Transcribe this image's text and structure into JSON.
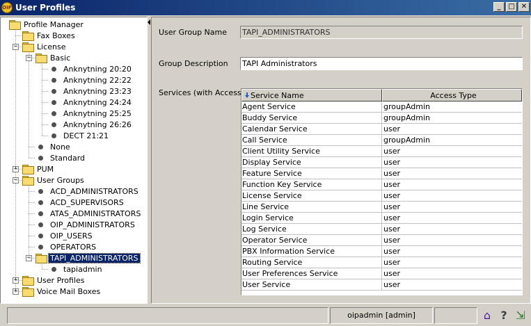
{
  "window": {
    "title": "User Profiles",
    "icon_text": "OIP",
    "buttons": {
      "minimize": "_",
      "maximize": "□",
      "close": "✕"
    }
  },
  "tree": {
    "items": [
      {
        "label": "Profile Manager",
        "type": "folder",
        "level": 0,
        "expanded": true
      },
      {
        "label": "Fax Boxes",
        "type": "folder",
        "level": 1
      },
      {
        "label": "License",
        "type": "folder",
        "level": 1,
        "expanded": true
      },
      {
        "label": "Basic",
        "type": "folder",
        "level": 2,
        "expanded": true
      },
      {
        "label": "Anknytning 20:20",
        "type": "leaf",
        "level": 3
      },
      {
        "label": "Anknytning 22:22",
        "type": "leaf",
        "level": 3
      },
      {
        "label": "Anknytning 23:23",
        "type": "leaf",
        "level": 3
      },
      {
        "label": "Anknytning 24:24",
        "type": "leaf",
        "level": 3
      },
      {
        "label": "Anknytning 25:25",
        "type": "leaf",
        "level": 3
      },
      {
        "label": "Anknytning 26:26",
        "type": "leaf",
        "level": 3
      },
      {
        "label": "DECT 21:21",
        "type": "leaf",
        "level": 3
      },
      {
        "label": "None",
        "type": "leaf",
        "level": 2
      },
      {
        "label": "Standard",
        "type": "leaf",
        "level": 2
      },
      {
        "label": "PUM",
        "type": "folder",
        "level": 1,
        "expanded": false
      },
      {
        "label": "User Groups",
        "type": "folder",
        "level": 1,
        "expanded": true
      },
      {
        "label": "ACD_ADMINISTRATORS",
        "type": "leaf",
        "level": 2
      },
      {
        "label": "ACD_SUPERVISORS",
        "type": "leaf",
        "level": 2
      },
      {
        "label": "ATAS_ADMINISTRATORS",
        "type": "leaf",
        "level": 2
      },
      {
        "label": "OIP_ADMINISTRATORS",
        "type": "leaf",
        "level": 2
      },
      {
        "label": "OIP_USERS",
        "type": "leaf",
        "level": 2
      },
      {
        "label": "OPERATORS",
        "type": "leaf",
        "level": 2
      },
      {
        "label": "TAPI_ADMINISTRATORS",
        "type": "folder",
        "level": 2,
        "expanded": true,
        "selected": true
      },
      {
        "label": "tapiadmin",
        "type": "leaf",
        "level": 3
      },
      {
        "label": "User Profiles",
        "type": "folder",
        "level": 1,
        "expanded": false
      },
      {
        "label": "Voice Mail Boxes",
        "type": "folder",
        "level": 1,
        "expanded": false
      }
    ]
  },
  "details": {
    "group_name_label": "User Group Name",
    "group_name_value": "TAPI_ADMINISTRATORS",
    "group_desc_label": "Group Description",
    "group_desc_value": "TAPI Administrators",
    "services_label": "Services (with Access)"
  },
  "services_table": {
    "columns": [
      "Service Name",
      "Access Type"
    ],
    "rows": [
      [
        "Agent Service",
        "groupAdmin"
      ],
      [
        "Buddy Service",
        "groupAdmin"
      ],
      [
        "Calendar Service",
        "user"
      ],
      [
        "Call Service",
        "groupAdmin"
      ],
      [
        "Client Utility Service",
        "user"
      ],
      [
        "Display Service",
        "user"
      ],
      [
        "Feature Service",
        "user"
      ],
      [
        "Function Key Service",
        "user"
      ],
      [
        "License Service",
        "user"
      ],
      [
        "Line Service",
        "user"
      ],
      [
        "Login Service",
        "user"
      ],
      [
        "Log Service",
        "user"
      ],
      [
        "Operator Service",
        "user"
      ],
      [
        "PBX Information Service",
        "user"
      ],
      [
        "Routing Service",
        "user"
      ],
      [
        "User Preferences Service",
        "user"
      ],
      [
        "User Service",
        "user"
      ]
    ]
  },
  "statusbar": {
    "user": "oipadmin [admin]",
    "icons": [
      "home-icon",
      "help-icon",
      "exit-icon"
    ]
  }
}
